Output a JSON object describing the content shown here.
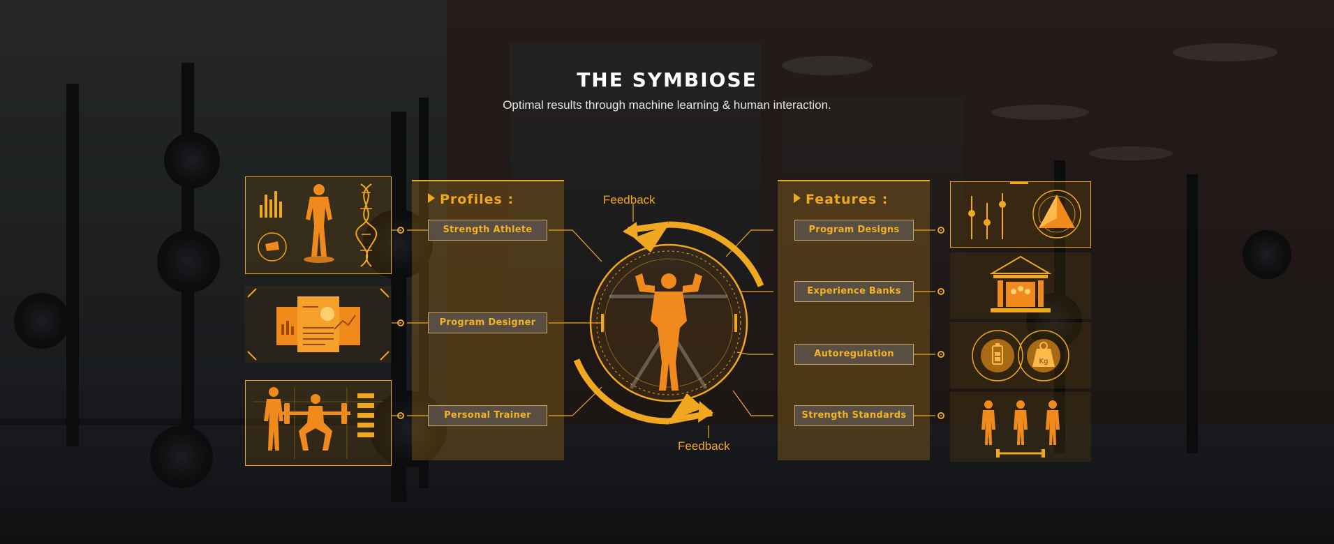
{
  "header": {
    "title": "THE SYMBIOSE",
    "subtitle": "Optimal results through machine learning & human interaction."
  },
  "profiles": {
    "heading": "Profiles :",
    "items": [
      {
        "label": "Strength Athlete",
        "icon": "athlete-dna-icon"
      },
      {
        "label": "Program Designer",
        "icon": "documents-chart-icon"
      },
      {
        "label": "Personal Trainer",
        "icon": "trainer-squat-icon"
      }
    ]
  },
  "features": {
    "heading": "Features :",
    "items": [
      {
        "label": "Program Designs",
        "icon": "sliders-radar-icon"
      },
      {
        "label": "Experience Banks",
        "icon": "bank-stars-icon"
      },
      {
        "label": "Autoregulation",
        "icon": "gears-battery-weight-icon"
      },
      {
        "label": "Strength Standards",
        "icon": "three-figures-scale-icon"
      }
    ]
  },
  "feedback": {
    "top": "Feedback",
    "bottom": "Feedback"
  },
  "icons": {
    "weight_label": "Kg"
  },
  "colors": {
    "accent": "#f0a821",
    "label_text": "#f5b324",
    "background": "#15171b"
  }
}
